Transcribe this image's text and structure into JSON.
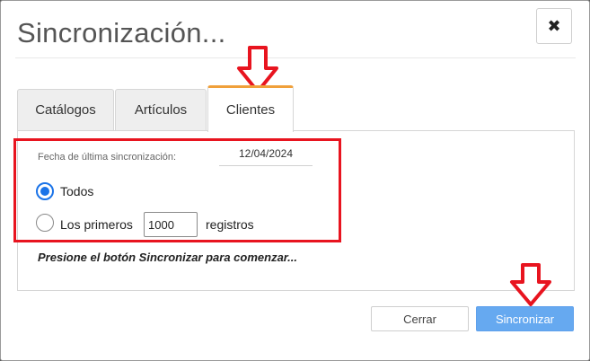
{
  "dialog": {
    "title": "Sincronización...",
    "close_glyph": "✖"
  },
  "tabs": [
    {
      "label": "Catálogos",
      "active": false
    },
    {
      "label": "Artículos",
      "active": false
    },
    {
      "label": "Clientes",
      "active": true
    }
  ],
  "clients": {
    "last_sync_label": "Fecha de última sincronización:",
    "last_sync_date": "12/04/2024",
    "option_all_label": "Todos",
    "option_all_checked": true,
    "option_first_label": "Los primeros",
    "option_first_count": "1000",
    "option_first_suffix": "registros",
    "hint": "Presione el botón Sincronizar para comenzar..."
  },
  "footer": {
    "cancel_label": "Cerrar",
    "sync_label": "Sincronizar"
  },
  "colors": {
    "accent_tab": "#f0a03a",
    "primary_button": "#66a9f0",
    "annotation_red": "#e8141f",
    "radio_blue": "#1a73e8"
  }
}
